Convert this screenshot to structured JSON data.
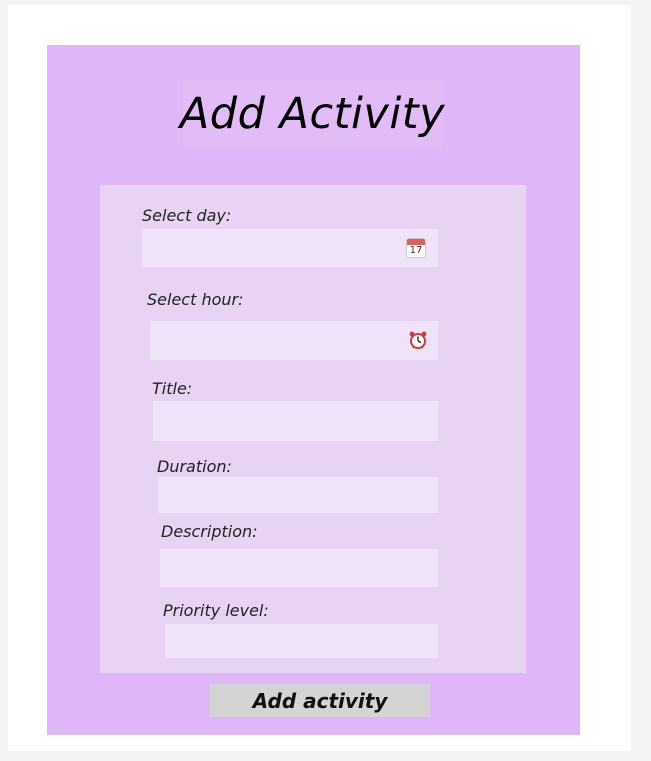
{
  "form": {
    "title": "Add Activity",
    "submit_label": "Add activity",
    "fields": {
      "day": {
        "label": "Select day:",
        "value": "",
        "icon": "calendar-icon",
        "icon_text": "17"
      },
      "hour": {
        "label": "Select hour:",
        "value": "",
        "icon": "alarm-clock-icon"
      },
      "title": {
        "label": "Title:",
        "value": ""
      },
      "duration": {
        "label": "Duration:",
        "value": ""
      },
      "description": {
        "label": "Description:",
        "value": ""
      },
      "priority": {
        "label": "Priority level:",
        "value": ""
      }
    }
  },
  "colors": {
    "page_background": "#f4f4f4",
    "panel_background": "#dfb6f8",
    "form_background": "#e8d3f2",
    "input_background": "#f0e2f8",
    "button_background": "#d4d4d4"
  }
}
